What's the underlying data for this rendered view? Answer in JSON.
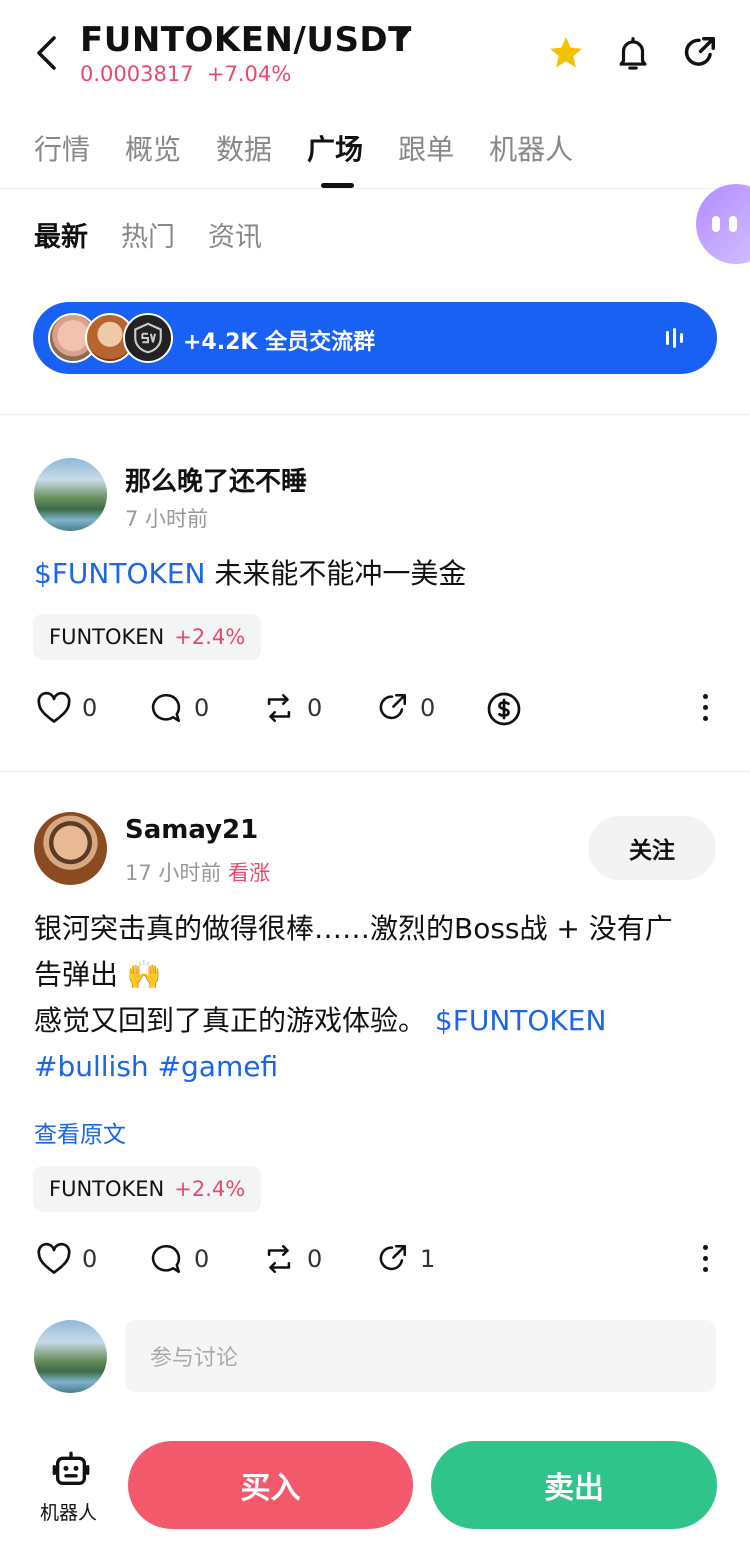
{
  "header": {
    "pair": "FUNTOKEN/USDT",
    "price": "0.0003817",
    "change": "+7.04%"
  },
  "tabs": [
    "行情",
    "概览",
    "数据",
    "广场",
    "跟单",
    "机器人"
  ],
  "subtabs": [
    "最新",
    "热门",
    "资讯"
  ],
  "group_banner": {
    "text": "+4.2K 全员交流群"
  },
  "posts": [
    {
      "username": "那么晚了还不睡",
      "time": "7 小时前",
      "ticker": "$FUNTOKEN",
      "text": " 未来能不能冲一美金",
      "chip": {
        "symbol": "FUNTOKEN",
        "change": "+2.4%"
      },
      "likes": "0",
      "comments": "0",
      "reposts": "0",
      "shares": "0"
    },
    {
      "username": "Samay21",
      "time": "17 小时前",
      "sentiment": "看涨",
      "follow_label": "关注",
      "line1": "银河突击真的做得很棒……激烈的Boss战 + 没有广",
      "line2": "告弹出 🙌",
      "line3": "感觉又回到了真正的游戏体验。",
      "ticker": " $FUNTOKEN",
      "tags": "#bullish #gamefi",
      "view_original": "查看原文",
      "chip": {
        "symbol": "FUNTOKEN",
        "change": "+2.4%"
      },
      "likes": "0",
      "comments": "0",
      "reposts": "0",
      "shares": "1"
    }
  ],
  "comment": {
    "placeholder": "参与讨论"
  },
  "bottom": {
    "robot_label": "机器人",
    "buy_label": "买入",
    "sell_label": "卖出"
  },
  "colors": {
    "accent_red": "#e8496b",
    "blue": "#1a66e6",
    "buy": "#f25a6b",
    "sell": "#2ec48a",
    "banner": "#1960f5",
    "star": "#f5c000"
  },
  "icons": [
    "back-icon",
    "dropdown-caret-icon",
    "star-icon",
    "bell-icon",
    "share-icon",
    "heart-icon",
    "comment-icon",
    "repost-icon",
    "share-arrow-icon",
    "tip-dollar-icon",
    "more-icon",
    "robot-icon",
    "voice-icon"
  ]
}
